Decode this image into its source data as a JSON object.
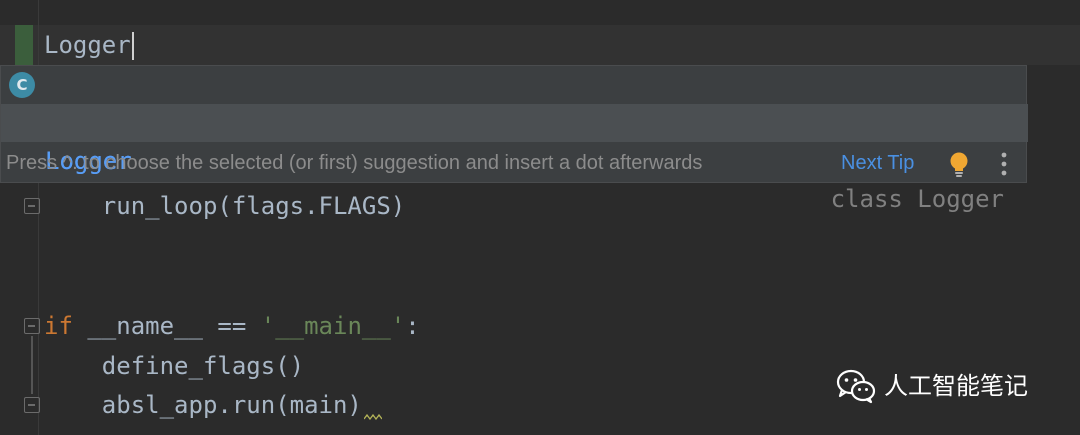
{
  "editor": {
    "current_line_text": "Logger",
    "code_lines": {
      "run_loop": "    run_loop(flags.FLAGS)",
      "if_kw": "if",
      "if_rest_1": " __name__ == ",
      "if_str": "'__main__'",
      "if_rest_2": ":",
      "define_flags": "    define_flags()",
      "absl_run": "    absl_app.run(main)"
    }
  },
  "completion": {
    "items": [
      {
        "name": "Logger",
        "type": "",
        "icon": "class-icon",
        "icon_letter": "C"
      },
      {
        "name": "Logger",
        "type": "class Logger"
      }
    ],
    "hint": "Press ^. to choose the selected (or first) suggestion and insert a dot afterwards",
    "next_tip": "Next Tip"
  },
  "watermark": {
    "text": "人工智能笔记"
  },
  "colors": {
    "background": "#2b2b2b",
    "popup": "#3c3f41",
    "selected_item": "#4b4f52",
    "item_name": "#589df6",
    "keyword": "#cc7832",
    "string": "#6a8759",
    "link": "#4a90e2",
    "bulb": "#f0a732"
  }
}
